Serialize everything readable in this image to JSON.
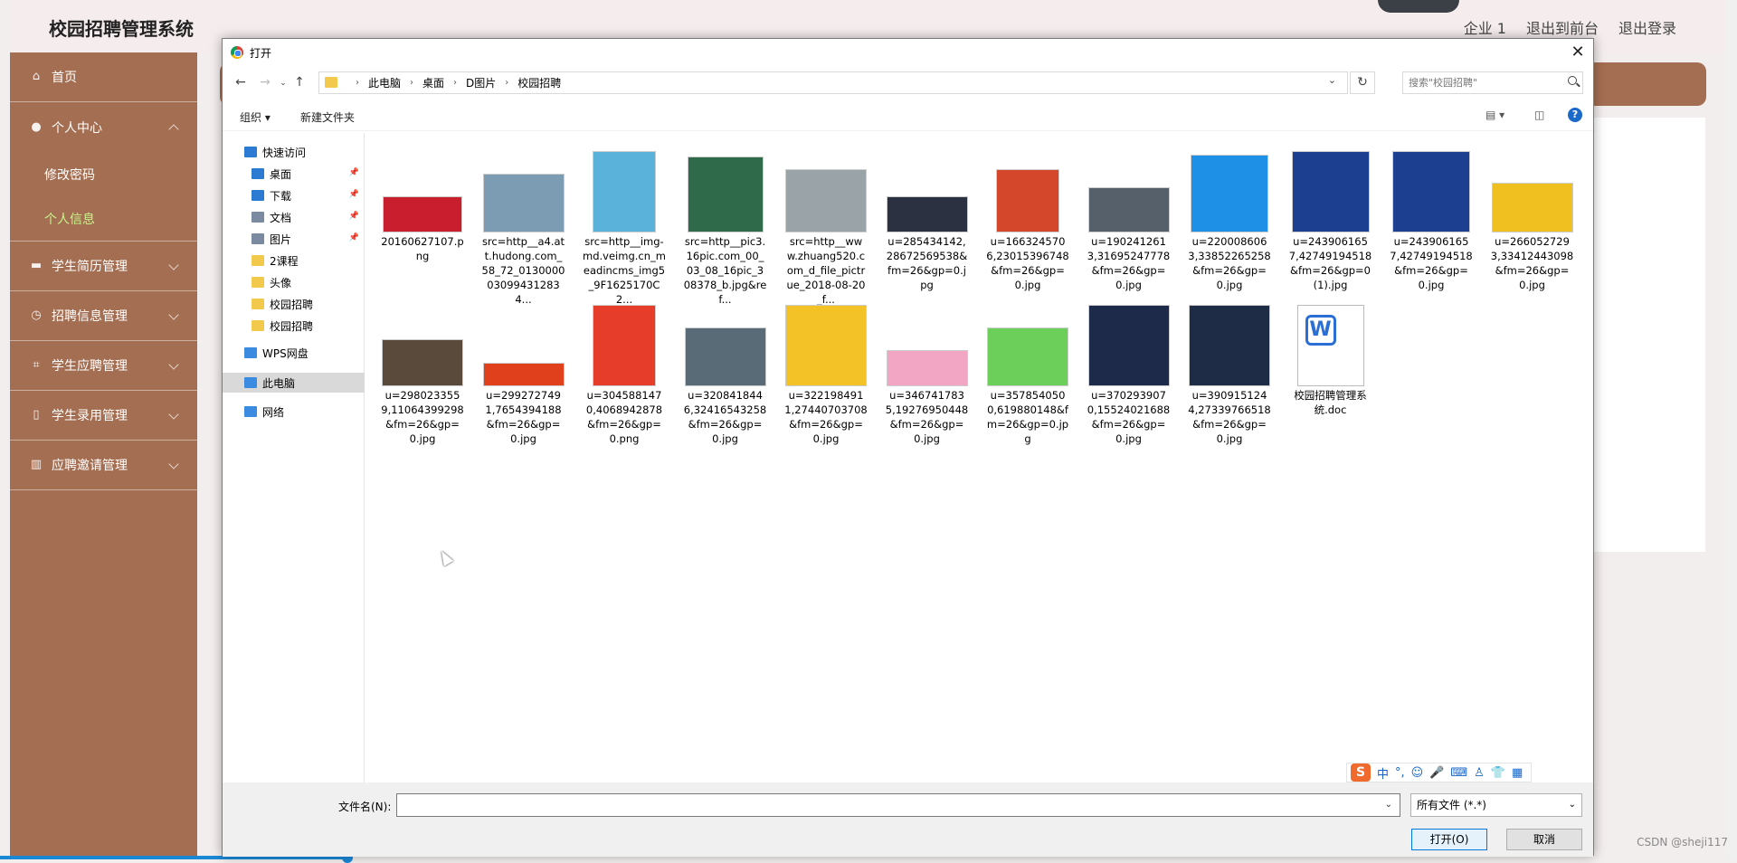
{
  "app": {
    "brand": "校园招聘管理系统",
    "topnav": [
      "企业 1",
      "退出到前台",
      "退出登录"
    ],
    "sidebar": {
      "home": "首页",
      "personal": "个人中心",
      "change_password": "修改密码",
      "personal_info": "个人信息",
      "groups": [
        "学生简历管理",
        "招聘信息管理",
        "学生应聘管理",
        "学生录用管理",
        "应聘邀请管理"
      ]
    },
    "footer": "CSDN @sheji117"
  },
  "dialog": {
    "title": "打开",
    "close_glyph": "✕",
    "breadcrumb": [
      "此电脑",
      "桌面",
      "D图片",
      "校园招聘"
    ],
    "search_placeholder": "搜索\"校园招聘\"",
    "toolbar": {
      "organize": "组织 ▾",
      "new_folder": "新建文件夹",
      "help": "?"
    },
    "nav": [
      {
        "label": "快速访问",
        "icon": "star-icon",
        "color": "#2b7bd3"
      },
      {
        "label": "桌面",
        "icon": "desktop-icon",
        "color": "#2b7bd3",
        "pin": true
      },
      {
        "label": "下载",
        "icon": "download-icon",
        "color": "#2b7bd3",
        "pin": true
      },
      {
        "label": "文档",
        "icon": "document-icon",
        "color": "#7a8aa0",
        "pin": true
      },
      {
        "label": "图片",
        "icon": "pictures-icon",
        "color": "#7a8aa0",
        "pin": true
      },
      {
        "label": "2课程",
        "icon": "folder-icon",
        "color": "#f2c94c"
      },
      {
        "label": "头像",
        "icon": "folder-icon",
        "color": "#f2c94c"
      },
      {
        "label": "校园招聘",
        "icon": "folder-icon",
        "color": "#f2c94c"
      },
      {
        "label": "校园招聘",
        "icon": "folder-icon",
        "color": "#f2c94c"
      },
      {
        "label": "WPS网盘",
        "icon": "cloud-icon",
        "color": "#3b8be0"
      },
      {
        "label": "此电脑",
        "icon": "computer-icon",
        "color": "#3b8be0",
        "selected": true
      },
      {
        "label": "网络",
        "icon": "network-icon",
        "color": "#3b8be0"
      }
    ],
    "files": [
      {
        "name": "20160627107.png",
        "thumb": "#c81e2d"
      },
      {
        "name": "src=http__a4.att.hudong.com_58_72_0130000030994312834...",
        "thumb": "#7b9cb3"
      },
      {
        "name": "src=http__img-md.veimg.cn_meadincms_img5_9F1625170C2...",
        "thumb": "#5ab1d9"
      },
      {
        "name": "src=http__pic3.16pic.com_00_03_08_16pic_308378_b.jpg&ref...",
        "thumb": "#2f6a4a"
      },
      {
        "name": "src=http__www.zhuang520.com_d_file_pictrue_2018-08-20_f...",
        "thumb": "#9aa3a8"
      },
      {
        "name": "u=285434142,28672569538&fm=26&gp=0.jpg",
        "thumb": "#2b3140"
      },
      {
        "name": "u=1663245706,23015396748&fm=26&gp=0.jpg",
        "thumb": "#d4472a"
      },
      {
        "name": "u=1902412613,31695247778&fm=26&gp=0.jpg",
        "thumb": "#55606a"
      },
      {
        "name": "u=2200086063,33852265258&fm=26&gp=0.jpg",
        "thumb": "#1e90e6"
      },
      {
        "name": "u=2439061657,42749194518&fm=26&gp=0(1).jpg",
        "thumb": "#1c3f8f"
      },
      {
        "name": "u=2439061657,42749194518&fm=26&gp=0.jpg",
        "thumb": "#1c3f8f"
      },
      {
        "name": "u=2660527293,33412443098&fm=26&gp=0.jpg",
        "thumb": "#f0c020"
      },
      {
        "name": "u=2980233559,11064399298&fm=26&gp=0.jpg",
        "thumb": "#5a4a3c"
      },
      {
        "name": "u=2992727491,7654394188&fm=26&gp=0.jpg",
        "thumb": "#e0401c"
      },
      {
        "name": "u=3045881470,4068942878&fm=26&gp=0.png",
        "thumb": "#e63c2a"
      },
      {
        "name": "u=3208418446,32416543258&fm=26&gp=0.jpg",
        "thumb": "#5a6b78"
      },
      {
        "name": "u=3221984911,27440703708&fm=26&gp=0.jpg",
        "thumb": "#f3c227"
      },
      {
        "name": "u=3467417835,19276950448&fm=26&gp=0.jpg",
        "thumb": "#f2a6c4"
      },
      {
        "name": "u=3578540500,619880148&fm=26&gp=0.jpg",
        "thumb": "#6ccf5a"
      },
      {
        "name": "u=3702939070,15524021688&fm=26&gp=0.jpg",
        "thumb": "#1d2a4a"
      },
      {
        "name": "u=3909151244,27339766518&fm=26&gp=0.jpg",
        "thumb": "#1e2c45"
      },
      {
        "name": "校园招聘管理系统.doc",
        "thumb": "doc"
      }
    ],
    "ime": [
      "中",
      "°,",
      "☺",
      "🎤",
      "⌨",
      "♙",
      "👕",
      "▦"
    ],
    "filename_label": "文件名(N):",
    "filename_value": "",
    "filetype": "所有文件 (*.*)",
    "open": "打开(O)",
    "cancel": "取消"
  }
}
